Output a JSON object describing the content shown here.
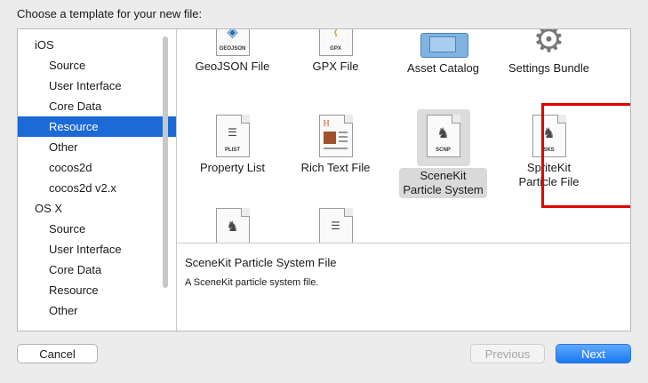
{
  "dialog": {
    "heading": "Choose a template for your new file:"
  },
  "sidebar": {
    "groups": [
      {
        "label": "iOS",
        "items": [
          "Source",
          "User Interface",
          "Core Data",
          "Resource",
          "Other",
          "cocos2d",
          "cocos2d v2.x"
        ]
      },
      {
        "label": "OS X",
        "items": [
          "Source",
          "User Interface",
          "Core Data",
          "Resource",
          "Other"
        ]
      }
    ],
    "selected": "Resource"
  },
  "templates": [
    {
      "label": "GeoJSON File",
      "icon_tag": "GEOJSON"
    },
    {
      "label": "GPX File",
      "icon_tag": "GPX"
    },
    {
      "label": "Asset Catalog",
      "icon": "folder-icon"
    },
    {
      "label": "Settings Bundle",
      "icon": "gear-icon"
    },
    {
      "label": "Property List",
      "icon_tag": "PLIST"
    },
    {
      "label": "Rich Text File",
      "icon": "rtf-document-icon"
    },
    {
      "label_line1": "SceneKit",
      "label_line2": "Particle System",
      "icon_tag": "SCNP"
    },
    {
      "label_line1": "SpriteKit",
      "label_line2": "Particle File",
      "icon_tag": "SKS"
    }
  ],
  "description": {
    "title": "SceneKit Particle System File",
    "text": "A SceneKit particle system file."
  },
  "buttons": {
    "cancel": "Cancel",
    "previous": "Previous",
    "next": "Next"
  },
  "colors": {
    "selection": "#1c6ad6",
    "highlight_box": "#e10000",
    "primary_button": "#1a78f2"
  }
}
